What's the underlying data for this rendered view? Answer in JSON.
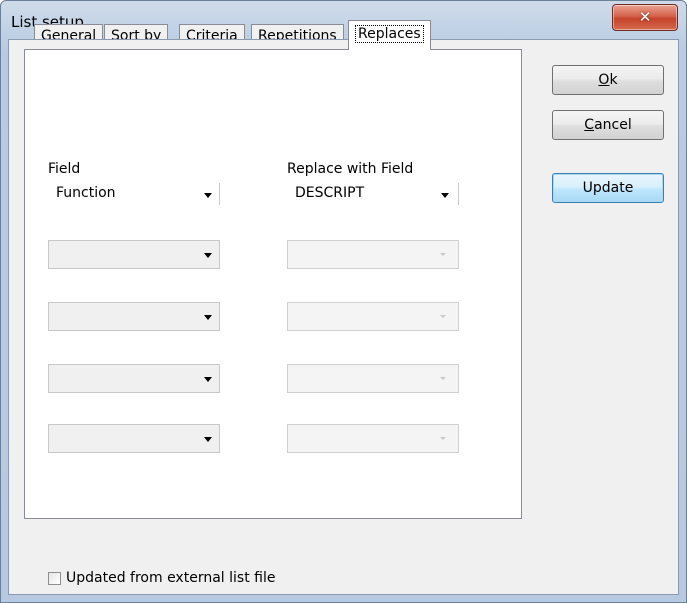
{
  "window": {
    "title": "List setup",
    "close_symbol": "✕"
  },
  "tabs": [
    {
      "label": "General"
    },
    {
      "label": "Sort by"
    },
    {
      "label": "Criteria"
    },
    {
      "label": "Repetitions"
    },
    {
      "label": "Replaces",
      "active": true
    }
  ],
  "replaces": {
    "field_header": "Field",
    "replace_header": "Replace with Field",
    "rows": [
      {
        "field": "Function",
        "replace": "DESCRIPT"
      },
      {
        "field": "",
        "replace": ""
      },
      {
        "field": "",
        "replace": ""
      },
      {
        "field": "",
        "replace": ""
      },
      {
        "field": "",
        "replace": ""
      }
    ]
  },
  "buttons": {
    "ok": {
      "mnemonic": "O",
      "rest": "k"
    },
    "cancel": {
      "mnemonic": "C",
      "rest": "ancel"
    },
    "update": "Update"
  },
  "external_file": {
    "label": "Updated from external list file",
    "checked": false
  }
}
